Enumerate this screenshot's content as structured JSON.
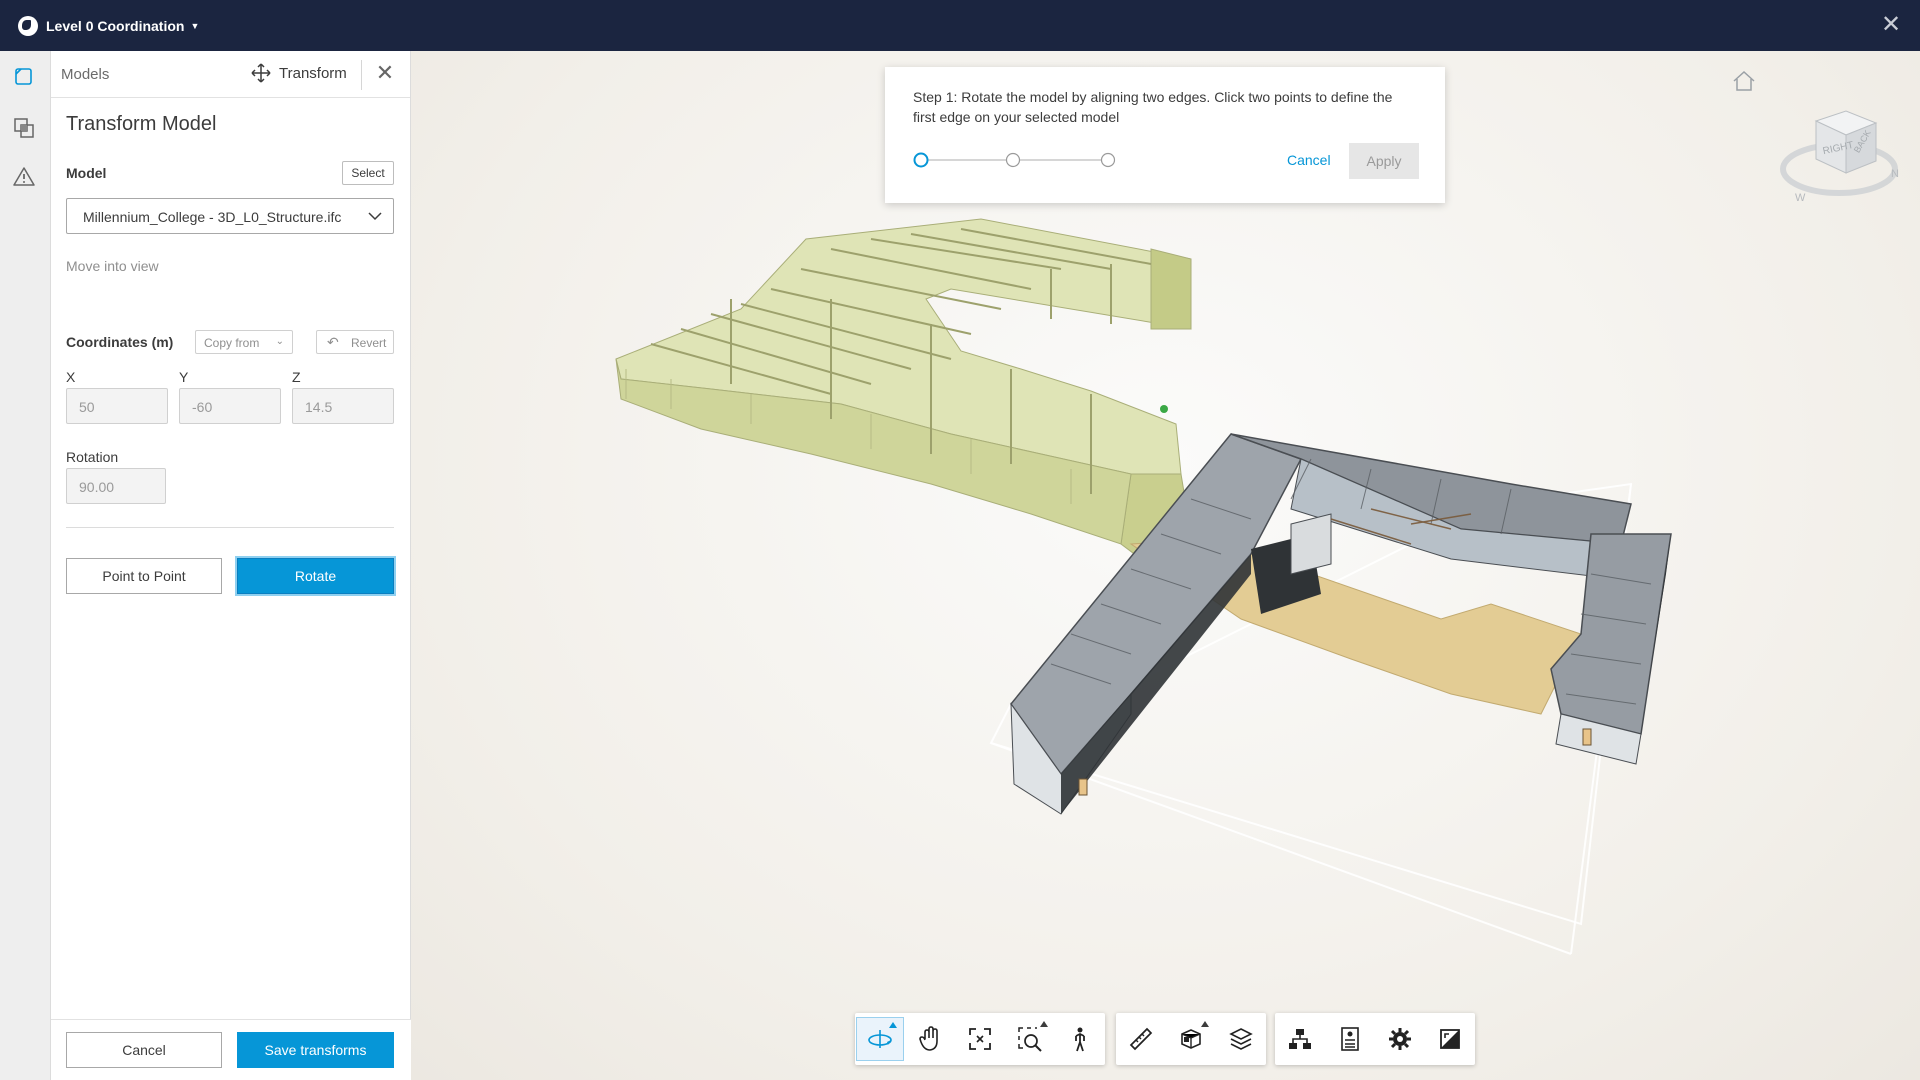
{
  "topbar": {
    "title": "Level 0 Coordination"
  },
  "panel": {
    "tab_models": "Models",
    "tab_transform": "Transform",
    "title": "Transform Model",
    "model_label": "Model",
    "select_button": "Select",
    "model_value": "Millennium_College - 3D_L0_Structure.ifc",
    "move_into_view": "Move into view",
    "coords_label": "Coordinates (m)",
    "copy_from": "Copy from",
    "revert": "Revert",
    "x_label": "X",
    "x_value": "50",
    "y_label": "Y",
    "y_value": "-60",
    "z_label": "Z",
    "z_value": "14.5",
    "rotation_label": "Rotation",
    "rotation_value": "90.00",
    "point_to_point": "Point to Point",
    "rotate": "Rotate",
    "cancel": "Cancel",
    "save": "Save transforms"
  },
  "step_card": {
    "text": "Step 1: Rotate the model by aligning two edges. Click two points to define the first edge on your selected model",
    "cancel": "Cancel",
    "apply": "Apply",
    "current_step": 1,
    "total_steps": 3
  },
  "viewcube": {
    "face_label": "RIGHT",
    "side_label": "BACK"
  },
  "colors": {
    "accent": "#0696d7",
    "topbar": "#1b2540",
    "structure_model": "#d8dfa8"
  },
  "toolbar_icons": [
    "orbit-icon",
    "pan-icon",
    "fit-to-view-icon",
    "zoom-window-icon",
    "first-person-icon",
    "measure-icon",
    "section-icon",
    "layers-icon",
    "model-browser-icon",
    "properties-icon",
    "settings-icon",
    "fullscreen-icon"
  ]
}
